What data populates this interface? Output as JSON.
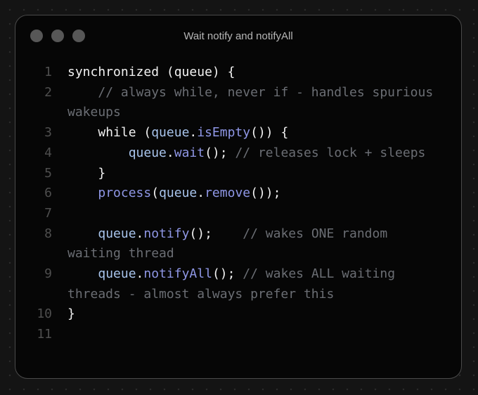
{
  "window": {
    "title": "Wait notify and notifyAll"
  },
  "colors": {
    "background": "#141414",
    "window": "#060606",
    "plain": "#f2f2f2",
    "variable": "#a8c4ec",
    "method": "#8f97e6",
    "comment": "#6b6e74",
    "line_number": "#4e4e4e"
  },
  "code": {
    "lines": [
      {
        "number": "1",
        "tokens": [
          {
            "kind": "plain",
            "text": "synchronized (queue) {"
          }
        ]
      },
      {
        "number": "2",
        "tokens": [
          {
            "kind": "plain",
            "text": "    "
          },
          {
            "kind": "comment",
            "text": "// always while, never if - handles spurious wakeups"
          }
        ]
      },
      {
        "number": "3",
        "tokens": [
          {
            "kind": "plain",
            "text": "    while ("
          },
          {
            "kind": "var",
            "text": "queue"
          },
          {
            "kind": "plain",
            "text": "."
          },
          {
            "kind": "method",
            "text": "isEmpty"
          },
          {
            "kind": "plain",
            "text": "()) {"
          }
        ]
      },
      {
        "number": "4",
        "tokens": [
          {
            "kind": "plain",
            "text": "        "
          },
          {
            "kind": "var",
            "text": "queue"
          },
          {
            "kind": "plain",
            "text": "."
          },
          {
            "kind": "method",
            "text": "wait"
          },
          {
            "kind": "plain",
            "text": "(); "
          },
          {
            "kind": "comment",
            "text": "// releases lock + sleeps"
          }
        ]
      },
      {
        "number": "5",
        "tokens": [
          {
            "kind": "plain",
            "text": "    }"
          }
        ]
      },
      {
        "number": "6",
        "tokens": [
          {
            "kind": "plain",
            "text": "    "
          },
          {
            "kind": "method",
            "text": "process"
          },
          {
            "kind": "plain",
            "text": "("
          },
          {
            "kind": "var",
            "text": "queue"
          },
          {
            "kind": "plain",
            "text": "."
          },
          {
            "kind": "method",
            "text": "remove"
          },
          {
            "kind": "plain",
            "text": "());"
          }
        ]
      },
      {
        "number": "7",
        "tokens": []
      },
      {
        "number": "8",
        "tokens": [
          {
            "kind": "plain",
            "text": "    "
          },
          {
            "kind": "var",
            "text": "queue"
          },
          {
            "kind": "plain",
            "text": "."
          },
          {
            "kind": "method",
            "text": "notify"
          },
          {
            "kind": "plain",
            "text": "();    "
          },
          {
            "kind": "comment",
            "text": "// wakes ONE random waiting thread"
          }
        ]
      },
      {
        "number": "9",
        "tokens": [
          {
            "kind": "plain",
            "text": "    "
          },
          {
            "kind": "var",
            "text": "queue"
          },
          {
            "kind": "plain",
            "text": "."
          },
          {
            "kind": "method",
            "text": "notifyAll"
          },
          {
            "kind": "plain",
            "text": "(); "
          },
          {
            "kind": "comment",
            "text": "// wakes ALL waiting threads - almost always prefer this"
          }
        ]
      },
      {
        "number": "10",
        "tokens": [
          {
            "kind": "plain",
            "text": "}"
          }
        ]
      },
      {
        "number": "11",
        "tokens": []
      }
    ]
  }
}
